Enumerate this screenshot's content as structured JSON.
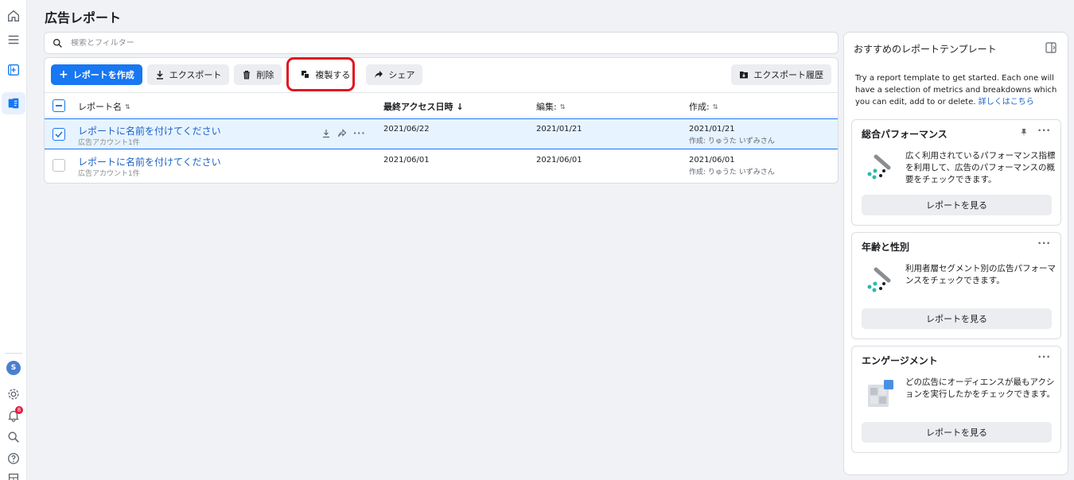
{
  "page": {
    "title": "広告レポート"
  },
  "search": {
    "placeholder": "検索とフィルター"
  },
  "toolbar": {
    "create_label": "レポートを作成",
    "export_label": "エクスポート",
    "delete_label": "削除",
    "duplicate_label": "複製する",
    "share_label": "シェア",
    "export_history_label": "エクスポート履歴"
  },
  "table": {
    "columns": {
      "name": "レポート名",
      "last_access": "最終アクセス日時",
      "edited": "編集:",
      "created": "作成:"
    },
    "rows": [
      {
        "name": "レポートに名前を付けてください",
        "sub": "広告アカウント1件",
        "last_access": "2021/06/22",
        "edited": "2021/01/21",
        "created": "2021/01/21",
        "created_by": "作成: りゅうた いずみさん",
        "selected": true
      },
      {
        "name": "レポートに名前を付けてください",
        "sub": "広告アカウント1件",
        "last_access": "2021/06/01",
        "edited": "2021/06/01",
        "created": "2021/06/01",
        "created_by": "作成: りゅうた いずみさん",
        "selected": false
      }
    ]
  },
  "panel": {
    "title": "おすすめのレポートテンプレート",
    "description": "Try a report template to get started. Each one will have a selection of metrics and breakdowns which you can edit, add to or delete.",
    "learn_more": "詳しくはこちら",
    "templates": [
      {
        "title": "総合パフォーマンス",
        "text": "広く利用されているパフォーマンス指標を利用して、広告のパフォーマンスの概要をチェックできます。",
        "button": "レポートを見る",
        "pinned": true
      },
      {
        "title": "年齢と性別",
        "text": "利用者層セグメント別の広告パフォーマンスをチェックできます。",
        "button": "レポートを見る",
        "pinned": false
      },
      {
        "title": "エンゲージメント",
        "text": "どの広告にオーディエンスが最もアクションを実行したかをチェックできます。",
        "button": "レポートを見る",
        "pinned": false
      }
    ]
  },
  "rail": {
    "avatar_letter": "S",
    "notification_count": "8"
  },
  "colors": {
    "accent": "#1877f2",
    "highlight": "#e0161f",
    "link": "#1a62c7"
  }
}
